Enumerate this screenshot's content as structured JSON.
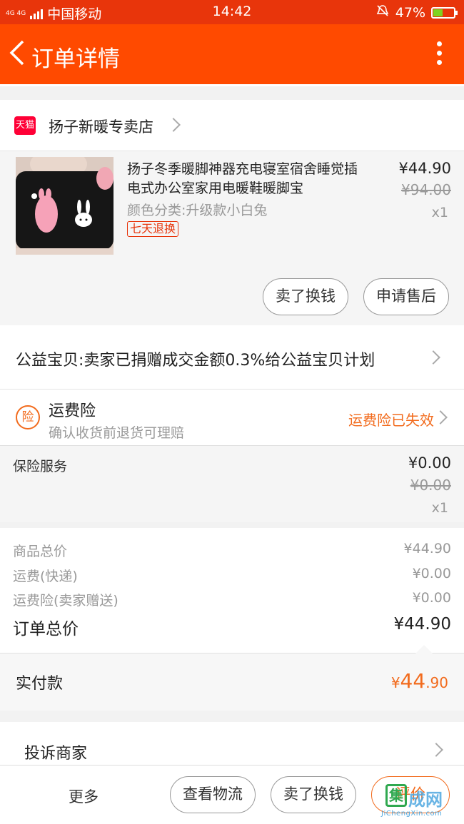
{
  "status_bar": {
    "network": "4G 4G",
    "carrier": "中国移动",
    "time": "14:42",
    "battery": "47%",
    "battery_level": 0.47
  },
  "header": {
    "title": "订单详情",
    "back_icon": "chevron-left-icon",
    "menu_icon": "more-vertical-icon"
  },
  "shop": {
    "badge": "天猫",
    "name": "扬子新暖专卖店"
  },
  "product": {
    "name": "扬子冬季暖脚神器充电寝室宿舍睡觉插电式办公室家用电暖鞋暖脚宝",
    "variant": "颜色分类:升级款小白兔",
    "tag": "七天退换",
    "price": "¥44.90",
    "original_price": "¥94.00",
    "quantity": "x1",
    "actions": [
      "卖了换钱",
      "申请售后"
    ]
  },
  "charity": {
    "text": "公益宝贝:卖家已捐赠成交金额0.3%给公益宝贝计划"
  },
  "insurance": {
    "icon_char": "险",
    "title": "运费险",
    "subtitle": "确认收货前退货可理赔",
    "status": "运费险已失效"
  },
  "service": {
    "label": "保险服务",
    "price": "¥0.00",
    "original_price": "¥0.00",
    "quantity": "x1"
  },
  "summary": {
    "rows": [
      {
        "label": "商品总价",
        "value": "¥44.90"
      },
      {
        "label": "运费(快递)",
        "value": "¥0.00"
      },
      {
        "label": "运费险(卖家赠送)",
        "value": "¥0.00"
      }
    ],
    "total_label": "订单总价",
    "total_value": "¥44.90"
  },
  "paid": {
    "label": "实付款",
    "currency": "¥",
    "integer": "44",
    "decimal": ".90"
  },
  "complain": {
    "label": "投诉商家"
  },
  "bottom_bar": {
    "more": "更多",
    "buttons": [
      "查看物流",
      "卖了换钱",
      "评价"
    ]
  },
  "watermark": {
    "box": "集",
    "text": "成网",
    "sub": "JiChengXin.com"
  },
  "colors": {
    "accent": "#ff4a00",
    "status_bar": "#e8350b",
    "orange_text": "#f26b1d",
    "tmall_red": "#ff0036"
  }
}
